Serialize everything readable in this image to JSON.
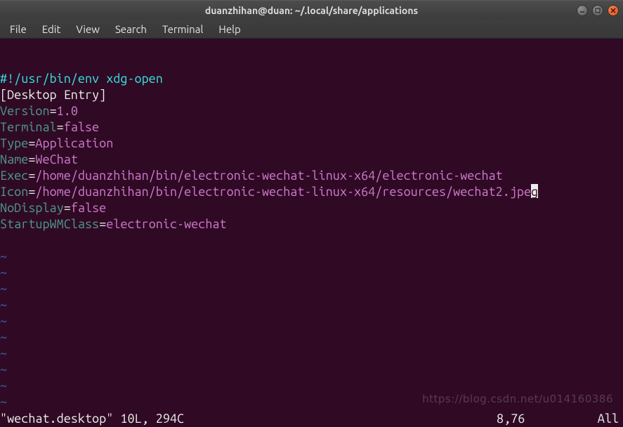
{
  "window": {
    "title": "duanzhihan@duan: ~/.local/share/applications"
  },
  "menubar": {
    "items": [
      "File",
      "Edit",
      "View",
      "Search",
      "Terminal",
      "Help"
    ]
  },
  "editor": {
    "shebang": "#!/usr/bin/env xdg-open",
    "section": "[Desktop Entry]",
    "entries": [
      {
        "key": "Version",
        "value": "1.0"
      },
      {
        "key": "Terminal",
        "value": "false"
      },
      {
        "key": "Type",
        "value": "Application"
      },
      {
        "key": "Name",
        "value": "WeChat"
      },
      {
        "key": "Exec",
        "value": "/home/duanzhihan/bin/electronic-wechat-linux-x64/electronic-wechat"
      },
      {
        "key": "Icon",
        "value": "/home/duanzhihan/bin/electronic-wechat-linux-x64/resources/wechat2.jpeg"
      },
      {
        "key": "NoDisplay",
        "value": "false"
      },
      {
        "key": "StartupWMClass",
        "value": "electronic-wechat"
      }
    ],
    "cursor": {
      "line_index": 7,
      "at_last_char": true
    },
    "tilde_lines": 11
  },
  "status": {
    "left": "\"wechat.desktop\" 10L, 294C",
    "position": "8,76",
    "percent": "All"
  },
  "watermark": "https://blog.csdn.net/u014160386"
}
